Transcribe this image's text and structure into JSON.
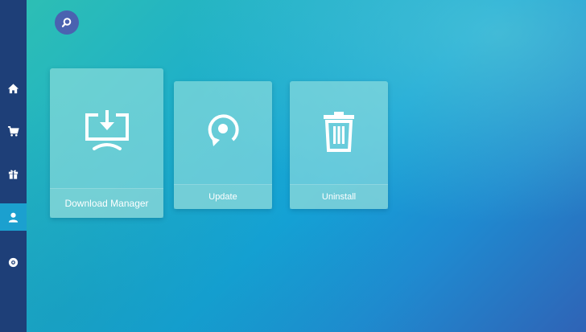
{
  "sidebar": {
    "items": [
      {
        "name": "home",
        "icon": "home-icon"
      },
      {
        "name": "store",
        "icon": "cart-icon"
      },
      {
        "name": "gifts",
        "icon": "gift-icon"
      },
      {
        "name": "account",
        "icon": "user-icon",
        "active": true
      },
      {
        "name": "settings",
        "icon": "gear-icon"
      }
    ]
  },
  "header": {
    "search_icon": "search-icon"
  },
  "tiles": [
    {
      "label": "Download Manager",
      "icon": "download-monitor-icon"
    },
    {
      "label": "Update",
      "icon": "refresh-icon"
    },
    {
      "label": "Uninstall",
      "icon": "trash-icon"
    }
  ],
  "colors": {
    "sidebar": "#1e3f78",
    "sidebar_active": "#1ba0cf",
    "search_button": "#4a62b0"
  }
}
